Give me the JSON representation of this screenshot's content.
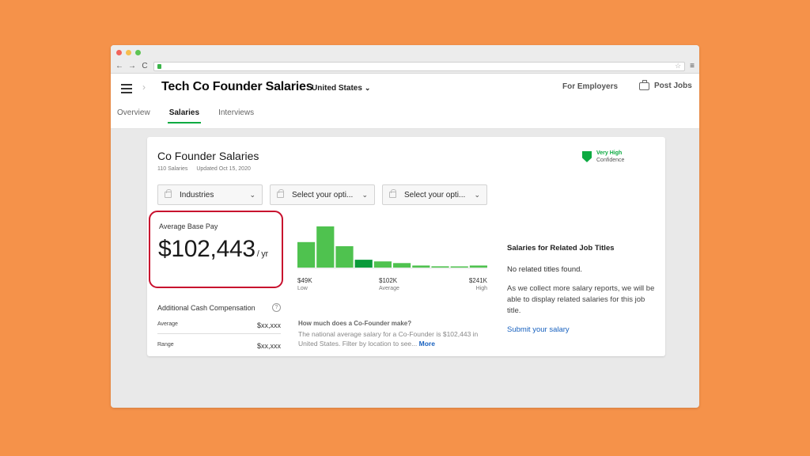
{
  "colors": {
    "background": "#f5924a",
    "accent": "#0caa41",
    "highlight": "#c8102e",
    "link": "#1861bf"
  },
  "header": {
    "title": "Tech Co Founder Salaries",
    "country": "United States",
    "for_employers": "For Employers",
    "post_jobs": "Post Jobs"
  },
  "tabs": [
    {
      "label": "Overview",
      "active": false
    },
    {
      "label": "Salaries",
      "active": true
    },
    {
      "label": "Interviews",
      "active": false
    }
  ],
  "card": {
    "title": "Co Founder Salaries",
    "count": "110 Salaries",
    "updated": "Updated Oct 15, 2020",
    "confidence_line1": "Very High",
    "confidence_line2": "Confidence",
    "filters": [
      {
        "label": "Industries"
      },
      {
        "label": "Select your opti..."
      },
      {
        "label": "Select your opti..."
      }
    ],
    "avg_label": "Average Base Pay",
    "avg_value": "$102,443",
    "avg_unit": "/ yr",
    "additional": {
      "title": "Additional Cash Compensation",
      "help": "?",
      "rows": [
        {
          "label": "Average",
          "value": "$xx,xxx"
        },
        {
          "label": "Range",
          "value": "$xx,xxx"
        }
      ]
    },
    "histogram_axis": {
      "low_value": "$49K",
      "low_label": "Low",
      "mid_value": "$102K",
      "mid_label": "Average",
      "high_value": "$241K",
      "high_label": "High"
    },
    "howmuch": {
      "question": "How much does a Co-Founder make?",
      "answer": "The national average salary for a Co-Founder is $102,443 in United States. Filter by location to see...",
      "more": "More"
    },
    "related": {
      "title": "Salaries for Related Job Titles",
      "none": "No related titles found.",
      "message": "As we collect more salary reports, we will be able to display related salaries for this job title.",
      "link": "Submit your salary"
    }
  },
  "chart_data": {
    "type": "bar",
    "values": [
      0.62,
      1.0,
      0.52,
      0.19,
      0.15,
      0.11,
      0.05,
      0.03,
      0.02,
      0.05
    ],
    "highlight_index": 3
  }
}
